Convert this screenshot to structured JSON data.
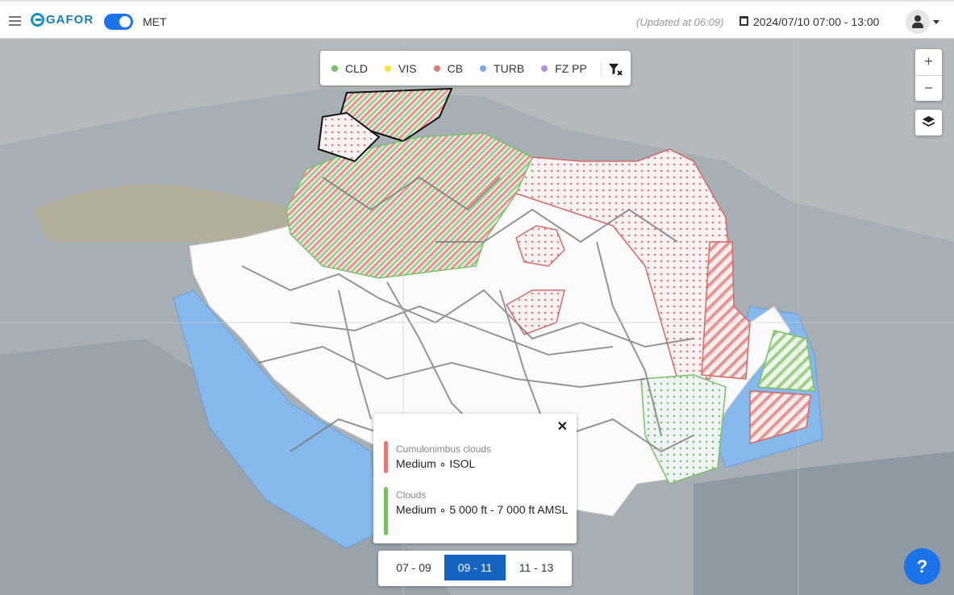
{
  "header": {
    "logo_text": "GAFOR",
    "toggle_label": "MET",
    "updated": "(Updated at 06:09)",
    "daterange": "2024/07/10 07:00 - 13:00"
  },
  "legend": {
    "items": [
      {
        "label": "CLD",
        "color": "#7cbf6a"
      },
      {
        "label": "VIS",
        "color": "#f2e23b"
      },
      {
        "label": "CB",
        "color": "#e07b7b"
      },
      {
        "label": "TURB",
        "color": "#7fa9e3"
      },
      {
        "label": "FZ PP",
        "color": "#b28fd6"
      }
    ]
  },
  "zoom": {
    "in": "+",
    "out": "−"
  },
  "popup": {
    "close": "✕",
    "groups": [
      {
        "title": "Cumulonimbus clouds",
        "text": "Medium ∘ ISOL",
        "color": "#e07b7b"
      },
      {
        "title": "Clouds",
        "text": "Medium ∘ 5 000 ft - 7 000 ft AMSL",
        "color": "#7cbf6a"
      }
    ]
  },
  "times": [
    "07 - 09",
    "09 - 11",
    "11 - 13"
  ],
  "help": "?"
}
